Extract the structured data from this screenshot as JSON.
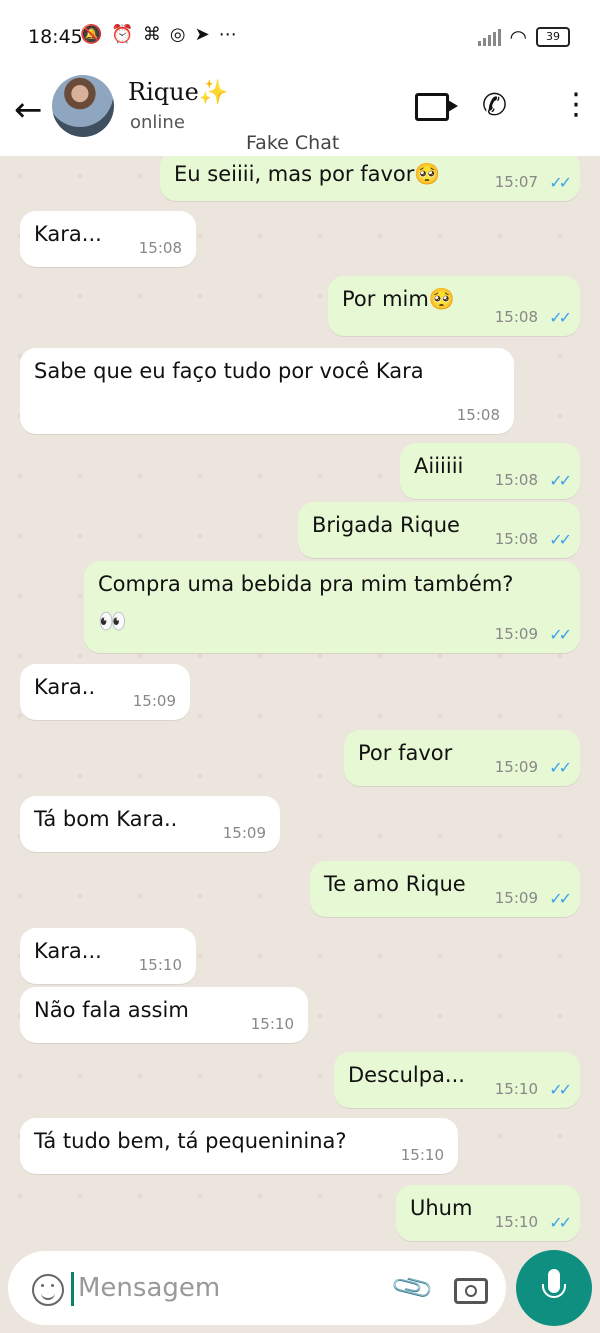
{
  "status_bar": {
    "time": "18:45",
    "battery": "39"
  },
  "header": {
    "contact_name": "Rique✨",
    "status": "online",
    "watermark": "Fake Chat"
  },
  "messages": [
    {
      "text": "Eu seiiii, mas por favor🥺",
      "time": "15:07"
    },
    {
      "text": "Kara...",
      "time": "15:08"
    },
    {
      "text": "Por mim🥺",
      "time": "15:08"
    },
    {
      "text": "Sabe que eu faço tudo por você Kara",
      "time": "15:08"
    },
    {
      "text": "Aiiiiii",
      "time": "15:08"
    },
    {
      "text": "Brigada Rique",
      "time": "15:08"
    },
    {
      "text": "Compra uma bebida pra mim também?",
      "time": "15:09"
    },
    {
      "text": "Kara..",
      "time": "15:09"
    },
    {
      "text": "Por favor",
      "time": "15:09"
    },
    {
      "text": "Tá bom Kara..",
      "time": "15:09"
    },
    {
      "text": "Te amo Rique",
      "time": "15:09"
    },
    {
      "text": "Kara...",
      "time": "15:10"
    },
    {
      "text": "Não fala assim",
      "time": "15:10"
    },
    {
      "text": "Desculpa...",
      "time": "15:10"
    },
    {
      "text": "Tá tudo bem, tá pequeninina?",
      "time": "15:10"
    },
    {
      "text": "Uhum",
      "time": "15:10"
    }
  ],
  "input": {
    "placeholder": "Mensagem"
  },
  "icons": {
    "back": "arrow-left-icon",
    "video": "video-call-icon",
    "call": "phone-icon",
    "more": "more-vertical-icon",
    "emoji": "emoji-icon",
    "attach": "paperclip-icon",
    "camera": "camera-icon",
    "mic": "microphone-icon"
  },
  "colors": {
    "incoming_bubble": "#ffffff",
    "outgoing_bubble": "#e7f8d4",
    "chat_background": "#ece5dd",
    "read_ticks": "#3aa0f0",
    "mic_button": "#0f8f7f"
  }
}
